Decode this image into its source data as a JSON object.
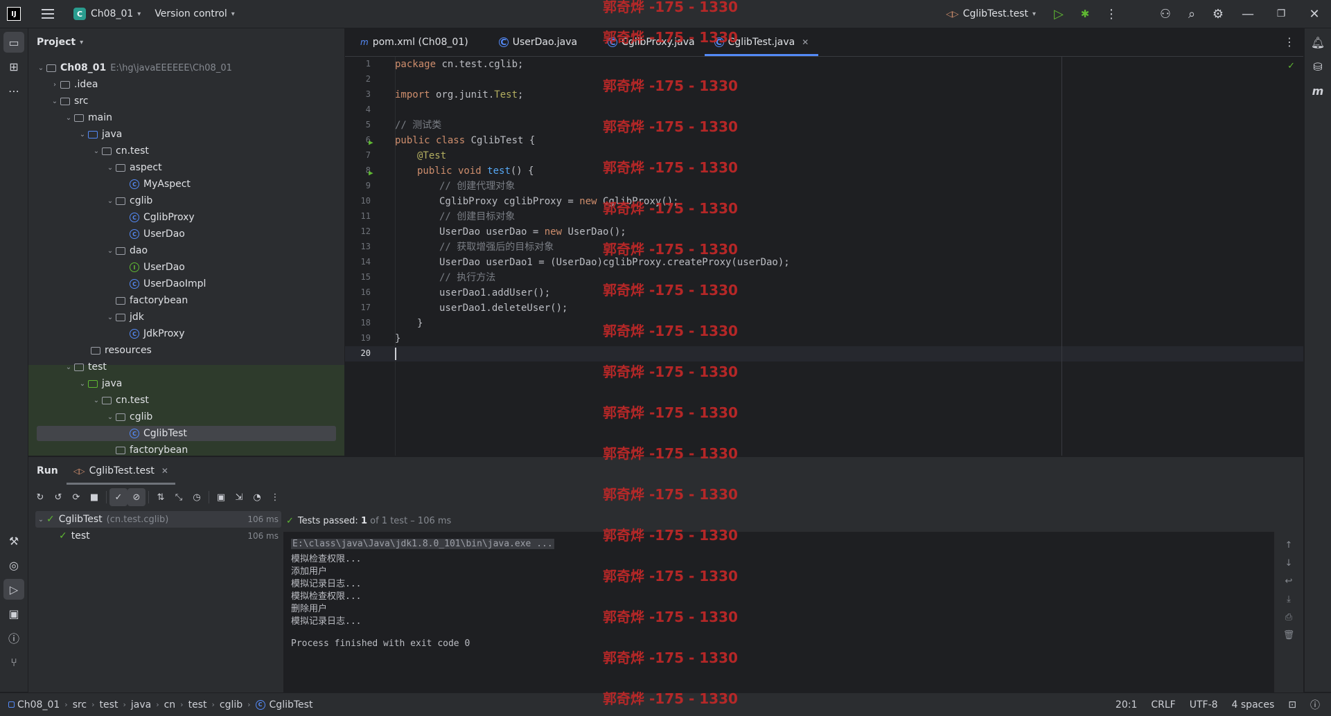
{
  "titlebar": {
    "app_logo": "IJ",
    "project_badge": "C",
    "project_name": "Ch08_01",
    "vcs": "Version control",
    "run_config": "CglibTest.test"
  },
  "project_panel": {
    "title": "Project",
    "root_name": "Ch08_01",
    "root_path": "E:\\hg\\javaEEEEEE\\Ch08_01",
    "items": [
      {
        "label": ".idea",
        "type": "folder"
      },
      {
        "label": "src",
        "type": "folder"
      },
      {
        "label": "main",
        "type": "folder"
      },
      {
        "label": "java",
        "type": "src-folder"
      },
      {
        "label": "cn.test",
        "type": "package"
      },
      {
        "label": "aspect",
        "type": "package"
      },
      {
        "label": "MyAspect",
        "type": "class"
      },
      {
        "label": "cglib",
        "type": "package"
      },
      {
        "label": "CglibProxy",
        "type": "class"
      },
      {
        "label": "UserDao",
        "type": "class"
      },
      {
        "label": "dao",
        "type": "package"
      },
      {
        "label": "UserDao",
        "type": "interface"
      },
      {
        "label": "UserDaoImpl",
        "type": "class"
      },
      {
        "label": "factorybean",
        "type": "package"
      },
      {
        "label": "jdk",
        "type": "package"
      },
      {
        "label": "JdkProxy",
        "type": "class"
      },
      {
        "label": "resources",
        "type": "folder"
      },
      {
        "label": "test",
        "type": "folder"
      },
      {
        "label": "java",
        "type": "src-folder"
      },
      {
        "label": "cn.test",
        "type": "package"
      },
      {
        "label": "cglib",
        "type": "package"
      },
      {
        "label": "CglibTest",
        "type": "class"
      },
      {
        "label": "factorybean",
        "type": "package"
      }
    ]
  },
  "editor": {
    "tabs": [
      {
        "label": "pom.xml (Ch08_01)",
        "icon": "m"
      },
      {
        "label": "UserDao.java",
        "icon": "C"
      },
      {
        "label": "CglibProxy.java",
        "icon": "C"
      },
      {
        "label": "CglibTest.java",
        "icon": "C"
      }
    ],
    "line_numbers": [
      "1",
      "2",
      "3",
      "4",
      "5",
      "6",
      "7",
      "8",
      "9",
      "10",
      "11",
      "12",
      "13",
      "14",
      "15",
      "16",
      "17",
      "18",
      "19",
      "20"
    ],
    "code": {
      "l1_kw": "package",
      "l1_rest": " cn.test.cglib;",
      "l3_kw": "import",
      "l3_rest": " org.junit.",
      "l3_cls": "Test",
      "l3_end": ";",
      "l5": "// 测试类",
      "l6_kw": "public class",
      "l6_rest": " CglibTest {",
      "l7": "@Test",
      "l8_kw": "public void",
      "l8_fn": "test",
      "l8_rest": "() {",
      "l9": "// 创建代理对象",
      "l10_a": "CglibProxy cglibProxy = ",
      "l10_kw": "new",
      "l10_b": " CglibProxy();",
      "l11": "// 创建目标对象",
      "l12_a": "UserDao userDao = ",
      "l12_kw": "new",
      "l12_b": " UserDao();",
      "l13": "// 获取增强后的目标对象",
      "l14": "UserDao userDao1 = (UserDao)cglibProxy.createProxy(userDao);",
      "l15": "// 执行方法",
      "l16": "userDao1.addUser();",
      "l17": "userDao1.deleteUser();",
      "l18": "}",
      "l19": "}"
    }
  },
  "run_panel": {
    "title": "Run",
    "tab_label": "CglibTest.test",
    "tests_status_prefix": "Tests passed:",
    "tests_status_count": "1",
    "tests_status_suffix": "of 1 test – 106 ms",
    "tree": [
      {
        "label": "CglibTest",
        "hint": "(cn.test.cglib)",
        "duration": "106 ms"
      },
      {
        "label": "test",
        "duration": "106 ms"
      }
    ],
    "console": [
      "E:\\class\\java\\Java\\jdk1.8.0_101\\bin\\java.exe ...",
      "模拟检查权限...",
      "添加用户",
      "模拟记录日志...",
      "模拟检查权限...",
      "删除用户",
      "模拟记录日志...",
      "",
      "Process finished with exit code 0"
    ]
  },
  "statusbar": {
    "breadcrumbs": [
      "Ch08_01",
      "src",
      "test",
      "java",
      "cn",
      "test",
      "cglib",
      "CglibTest"
    ],
    "position": "20:1",
    "line_sep": "CRLF",
    "encoding": "UTF-8",
    "indent": "4 spaces"
  },
  "watermark": "郭奇烨 -175 - 1330"
}
